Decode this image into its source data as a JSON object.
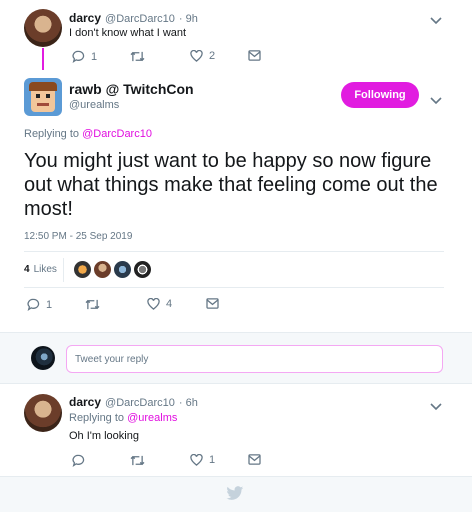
{
  "colors": {
    "accent": "#e11ce0",
    "muted": "#657786",
    "text": "#14171a",
    "divider": "#e6ecf0",
    "band": "#f5f8fa"
  },
  "parent_tweet": {
    "name": "darcy",
    "handle": "@DarcDarc10",
    "time": "· 9h",
    "text": "I don't know what I want",
    "replies": "1",
    "retweets": "",
    "likes": "2"
  },
  "main_tweet": {
    "name": "rawb @ TwitchCon",
    "handle": "@urealms",
    "follow_button": "Following",
    "replying_label": "Replying to",
    "replying_to": "@DarcDarc10",
    "text": "You might just want to be happy so now figure out what things make that feeling come out the most!",
    "timestamp": "12:50 PM - 25 Sep 2019",
    "likes_count": "4",
    "likes_label": "Likes",
    "replies": "1",
    "retweets": "",
    "likes": "4"
  },
  "reply_box": {
    "placeholder": "Tweet your reply"
  },
  "reply_tweet": {
    "name": "darcy",
    "handle": "@DarcDarc10",
    "time": "· 6h",
    "replying_label": "Replying to",
    "replying_to": "@urealms",
    "text": "Oh I'm looking",
    "replies": "",
    "retweets": "",
    "likes": "1"
  },
  "icons": [
    "reply-icon",
    "retweet-icon",
    "heart-icon",
    "message-icon",
    "chevron-down-icon",
    "twitter-bird-icon"
  ]
}
